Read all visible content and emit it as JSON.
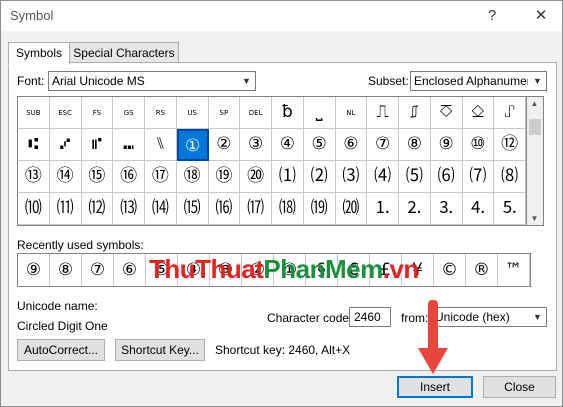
{
  "window": {
    "title": "Symbol",
    "help_label": "?",
    "close_label": "✕"
  },
  "tabs": [
    {
      "label": "Symbols",
      "active": true
    },
    {
      "label": "Special Characters",
      "active": false
    }
  ],
  "font": {
    "label": "Font:",
    "value": "Arial Unicode MS"
  },
  "subset": {
    "label": "Subset:",
    "value": "Enclosed Alphanumeri"
  },
  "symbol_grid": {
    "rows": [
      [
        "SUB",
        "ESC",
        "FS",
        "GS",
        "RS",
        "US",
        "SP",
        "DEL",
        "ƀ",
        "⎵",
        "NL",
        "⎍",
        "⎎",
        "⎏",
        "⎐",
        "⑀"
      ],
      [
        "⑆",
        "⑇",
        "⑈",
        "⑉",
        "⑊",
        "①",
        "②",
        "③",
        "④",
        "⑤",
        "⑥",
        "⑦",
        "⑧",
        "⑨",
        "⑩",
        "⑫"
      ],
      [
        "⑬",
        "⑭",
        "⑮",
        "⑯",
        "⑰",
        "⑱",
        "⑲",
        "⑳",
        "⑴",
        "⑵",
        "⑶",
        "⑷",
        "⑸",
        "⑹",
        "⑺",
        "⑻"
      ],
      [
        "⑽",
        "⑾",
        "⑿",
        "⒀",
        "⒁",
        "⒂",
        "⒃",
        "⒄",
        "⒅",
        "⒆",
        "⒇",
        "⒈",
        "⒉",
        "⒊",
        "⒋",
        "⒌"
      ]
    ],
    "selected": "①"
  },
  "recent": {
    "label": "Recently used symbols:",
    "symbols": [
      "⑨",
      "⑧",
      "⑦",
      "⑥",
      "⑤",
      "④",
      "③",
      "②",
      "①",
      "§",
      "€",
      "£",
      "¥",
      "©",
      "®",
      "™"
    ]
  },
  "watermark": {
    "part1": "ThuThuat",
    "part2": "PhanMem",
    "part3": ".vn"
  },
  "unicode_name": {
    "label": "Unicode name:",
    "value": "Circled Digit One"
  },
  "char_code": {
    "label": "Character code:",
    "value": "2460"
  },
  "from": {
    "label": "from:",
    "value": "Unicode (hex)"
  },
  "buttons": {
    "autocorrect": "AutoCorrect...",
    "shortcut_key": "Shortcut Key...",
    "insert": "Insert",
    "close": "Close"
  },
  "shortcut_text": "Shortcut key: 2460, Alt+X",
  "colors": {
    "accent": "#0078d7",
    "arrow": "#e8453c"
  }
}
